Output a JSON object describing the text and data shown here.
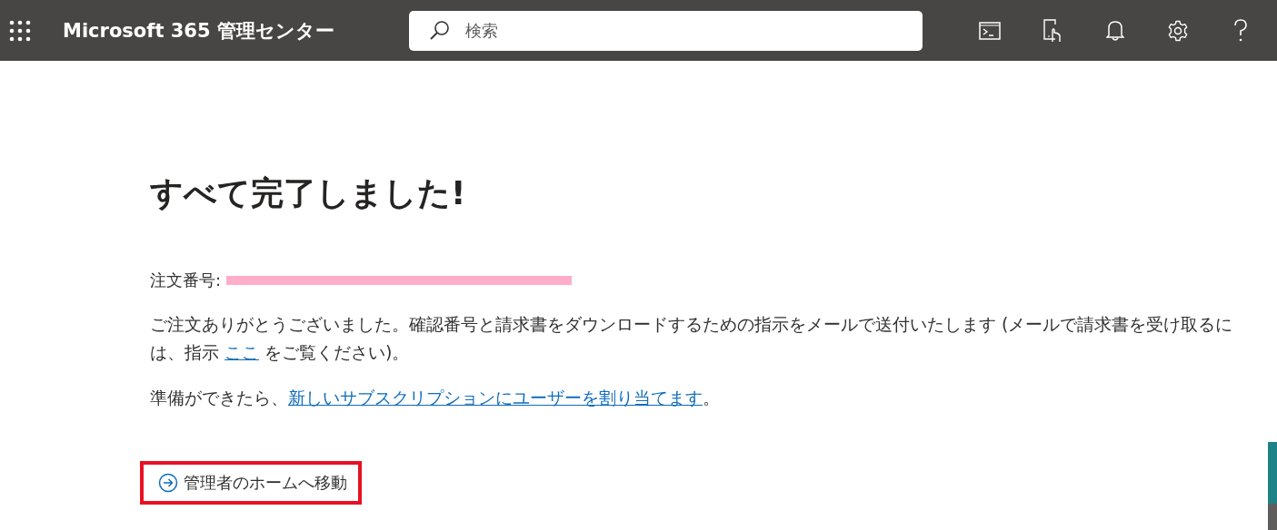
{
  "header": {
    "title": "Microsoft 365 管理センター",
    "search": {
      "placeholder": "検索"
    }
  },
  "heading": "すべて完了しました!",
  "order": {
    "label": "注文番号:",
    "redacted": true
  },
  "message": {
    "before": "ご注文ありがとうございました。確認番号と請求書をダウンロードするための指示をメールで送付いたします (メールで請求書を受け取るには、指示 ",
    "link": "ここ",
    "after": " をご覧ください)。"
  },
  "next_step": {
    "before": "準備ができたら、",
    "link": "新しいサブスクリプションにユーザーを割り当てます",
    "after": "。"
  },
  "home_link": {
    "label": "管理者のホームへ移動",
    "highlighted": true
  }
}
